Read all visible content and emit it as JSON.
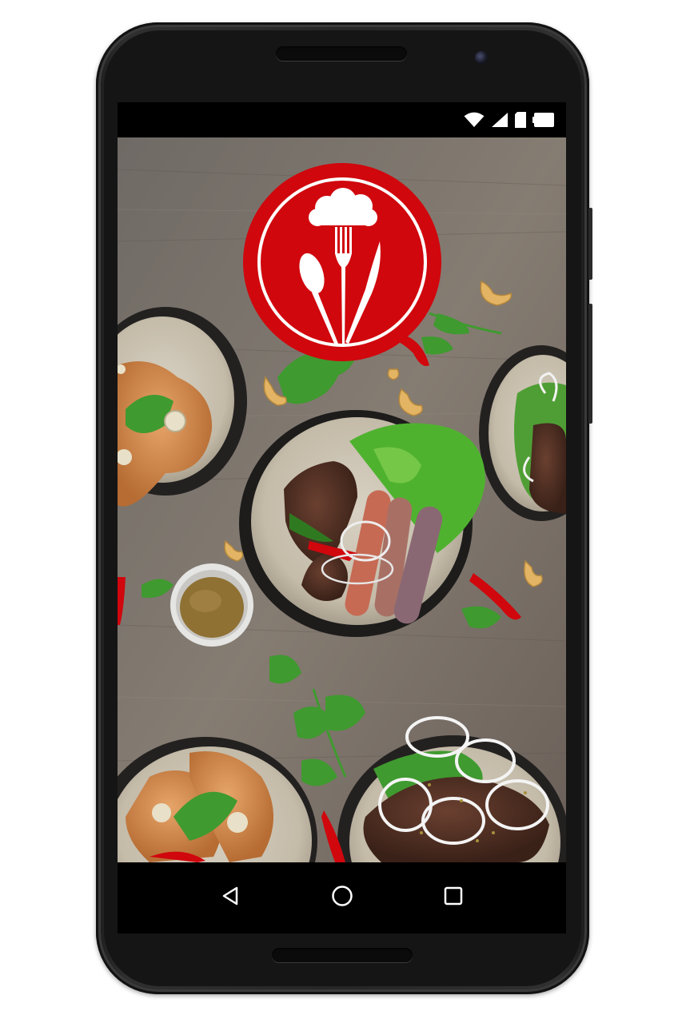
{
  "app": {
    "screen": "splash",
    "logo_icon": "chef-hat-cutlery-logo",
    "background": "food-platter-photo"
  },
  "colors": {
    "logo_red": "#d0070d",
    "logo_white": "#ffffff",
    "wood": "#7b746c",
    "bar": "#000000"
  },
  "status_bar": {
    "icons": [
      "wifi-icon",
      "cellular-signal-icon",
      "sim-card-icon",
      "battery-icon"
    ]
  },
  "nav_bar": {
    "buttons": [
      "back-icon",
      "home-icon",
      "recents-icon"
    ]
  }
}
